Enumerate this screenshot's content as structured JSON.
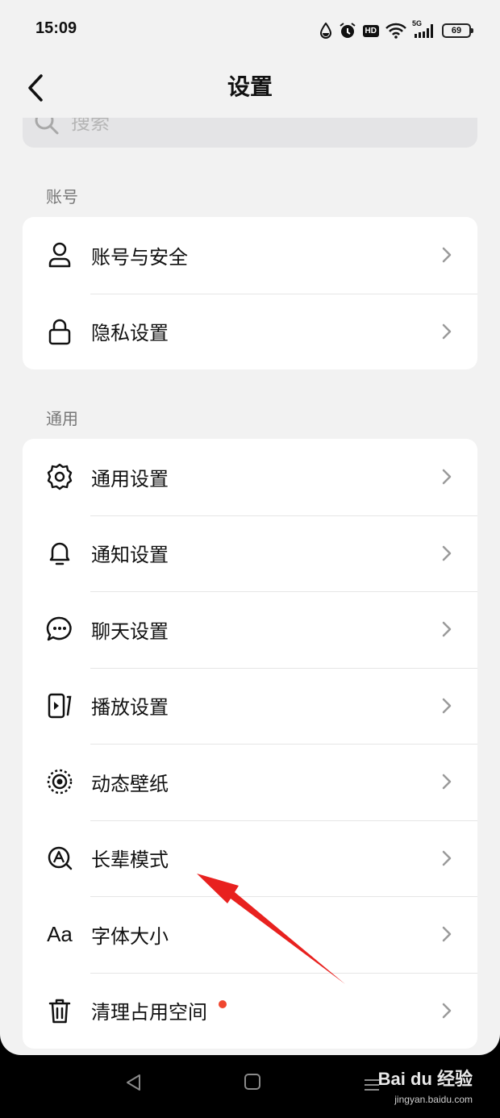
{
  "status_bar": {
    "time": "15:09",
    "hd": "HD",
    "network": "5G",
    "battery": "69"
  },
  "header": {
    "title": "设置"
  },
  "search": {
    "placeholder": "搜索"
  },
  "sections": [
    {
      "label": "账号",
      "items": [
        {
          "label": "账号与安全",
          "icon": "person-icon"
        },
        {
          "label": "隐私设置",
          "icon": "lock-icon"
        }
      ]
    },
    {
      "label": "通用",
      "items": [
        {
          "label": "通用设置",
          "icon": "gear-icon"
        },
        {
          "label": "通知设置",
          "icon": "bell-icon"
        },
        {
          "label": "聊天设置",
          "icon": "chat-bubble-icon"
        },
        {
          "label": "播放设置",
          "icon": "play-icon"
        },
        {
          "label": "动态壁纸",
          "icon": "wallpaper-icon"
        },
        {
          "label": "长辈模式",
          "icon": "elder-mode-icon"
        },
        {
          "label": "字体大小",
          "icon": "font-size-icon",
          "icon_text": "Aa"
        },
        {
          "label": "清理占用空间",
          "icon": "trash-icon",
          "badge_dot": true
        }
      ]
    }
  ],
  "watermark": {
    "logo": "Bai du 经验",
    "url": "jingyan.baidu.com"
  },
  "colors": {
    "accent_dot": "#f0462f",
    "annotation_arrow": "#e8211f",
    "background": "#f2f2f2"
  }
}
